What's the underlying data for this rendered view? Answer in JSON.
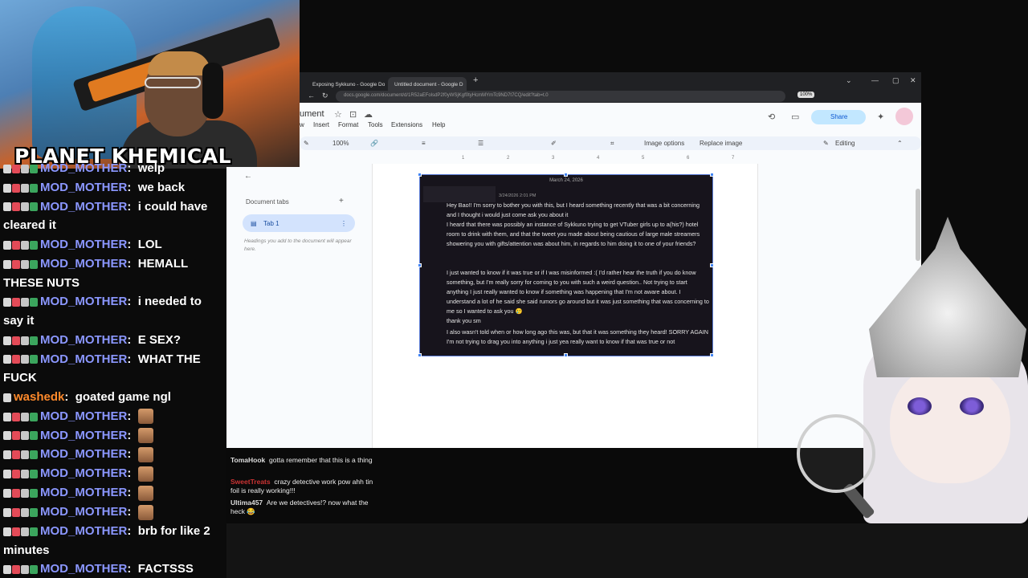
{
  "stream": {
    "channel_name": "PLANET KHEMICAL"
  },
  "left_chat": [
    {
      "user": "MOD_MOTHER",
      "color": "#8b97ff",
      "message": "welp"
    },
    {
      "user": "MOD_MOTHER",
      "color": "#8b97ff",
      "message": "we back"
    },
    {
      "user": "MOD_MOTHER",
      "color": "#8b97ff",
      "message": "i could have cleared it"
    },
    {
      "user": "MOD_MOTHER",
      "color": "#8b97ff",
      "message": "LOL"
    },
    {
      "user": "MOD_MOTHER",
      "color": "#8b97ff",
      "message": "HEMALL THESE NUTS"
    },
    {
      "user": "MOD_MOTHER",
      "color": "#8b97ff",
      "message": "i needed to say it"
    },
    {
      "user": "MOD_MOTHER",
      "color": "#8b97ff",
      "message": "E SEX?"
    },
    {
      "user": "MOD_MOTHER",
      "color": "#8b97ff",
      "message": "WHAT THE FUCK"
    },
    {
      "user": "washedk",
      "color": "#ff8a2b",
      "message": "goated game ngl"
    },
    {
      "user": "MOD_MOTHER",
      "color": "#8b97ff",
      "message": ""
    },
    {
      "user": "MOD_MOTHER",
      "color": "#8b97ff",
      "message": ""
    },
    {
      "user": "MOD_MOTHER",
      "color": "#8b97ff",
      "message": ""
    },
    {
      "user": "MOD_MOTHER",
      "color": "#8b97ff",
      "message": ""
    },
    {
      "user": "MOD_MOTHER",
      "color": "#8b97ff",
      "message": ""
    },
    {
      "user": "MOD_MOTHER",
      "color": "#8b97ff",
      "message": ""
    },
    {
      "user": "MOD_MOTHER",
      "color": "#8b97ff",
      "message": "brb for like 2 minutes"
    },
    {
      "user": "MOD_MOTHER",
      "color": "#8b97ff",
      "message": "FACTSSS"
    }
  ],
  "browser": {
    "tabs": [
      "Exposing Sykkuno - Google Do",
      "Untitled document - Google D"
    ],
    "new_tab": "+",
    "url": "docs.google.com/document/d/1R52aEFolsdP2f0yWSjKgf0tyHcmMYmTc9ND7t7CQ/edit?tab=t.0",
    "zoom_badge": "100%"
  },
  "docs": {
    "title": "ument",
    "menu": [
      "w",
      "Insert",
      "Format",
      "Tools",
      "Extensions",
      "Help"
    ],
    "toolbar": {
      "zoom": "100%",
      "image_options": "Image options",
      "replace_image": "Replace image",
      "mode": "Editing"
    },
    "share": "Share",
    "ruler_ticks": [
      "1",
      "2",
      "3",
      "4",
      "5",
      "6",
      "7"
    ],
    "document_tabs_label": "Document tabs",
    "tab_label": "Tab 1",
    "hint": "Headings you add to the document will appear here."
  },
  "screenshot_text": {
    "date": "March 24, 2026",
    "timestamp": "3/24/2026 2:01 PM",
    "paragraphs": [
      "Hey Bao!! I'm sorry to bother you with this, but I heard something recently that was a bit concerning and I thought i would just come ask you about it",
      "I heard that there was possibly an instance of Sykkuno trying to get VTuber girls up to a(his?) hotel room to drink with them, and that the tweet you made about being cautious of large male streamers showering you with gifts/attention was about him, in regards to him doing it to one of your friends?",
      "I just wanted to know if it was true or if I was misinformed :( I'd rather hear the truth if you do know something, but I'm really sorry for coming to you with such a weird question.. Not trying to start anything I just really wanted to know if something was happening that I'm not aware about. I understand a lot of he said she said rumors go around but it was just something that was concerning to me so I wanted to ask you 🥲",
      "thank you sm",
      "I also wasn't told when or how long ago this was, but that it was something they heard! SORRY AGAIN I'm not trying to drag you into anything i just yea really want to know if that was true or not"
    ]
  },
  "bottom_chat": [
    {
      "user": "TomaHook",
      "message": "gotta remember that this is a thing"
    },
    {
      "user": "SweetTreats",
      "message": "crazy detective work pow ahh tin foil is really working!!!"
    },
    {
      "user": "Ultima457",
      "message": "Are we detectives!? now what the heck 😂"
    }
  ]
}
